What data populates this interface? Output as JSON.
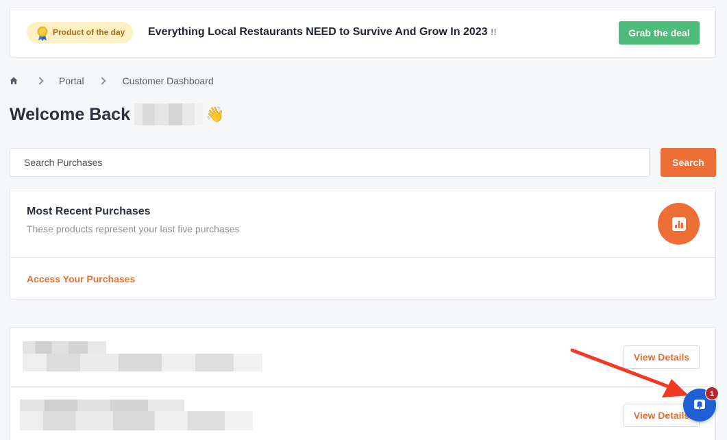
{
  "banner": {
    "badge_label": "Product of the day",
    "title": "Everything Local Restaurants NEED to Survive And Grow In 2023",
    "title_suffix": "!!",
    "cta_label": "Grab the deal"
  },
  "breadcrumb": {
    "items": [
      "Portal",
      "Customer Dashboard"
    ]
  },
  "welcome": {
    "text": "Welcome Back",
    "emoji": "👋"
  },
  "search": {
    "placeholder": "Search Purchases",
    "button_label": "Search"
  },
  "recent": {
    "title": "Most Recent Purchases",
    "subtitle": "These products represent your last five purchases",
    "link_label": "Access Your Purchases"
  },
  "purchases": [
    {
      "button_label": "View Details"
    },
    {
      "button_label": "View Details"
    }
  ],
  "notifications": {
    "count": "1"
  },
  "colors": {
    "accent": "#ee6f35",
    "deal_green": "#4dbb7a",
    "bell_blue": "#1f5fd6",
    "badge_red": "#b3262c",
    "arrow_red": "#f03a24"
  },
  "icons": [
    "medal-icon",
    "home-icon",
    "chevron-right-icon",
    "chart-icon",
    "bell-icon"
  ]
}
